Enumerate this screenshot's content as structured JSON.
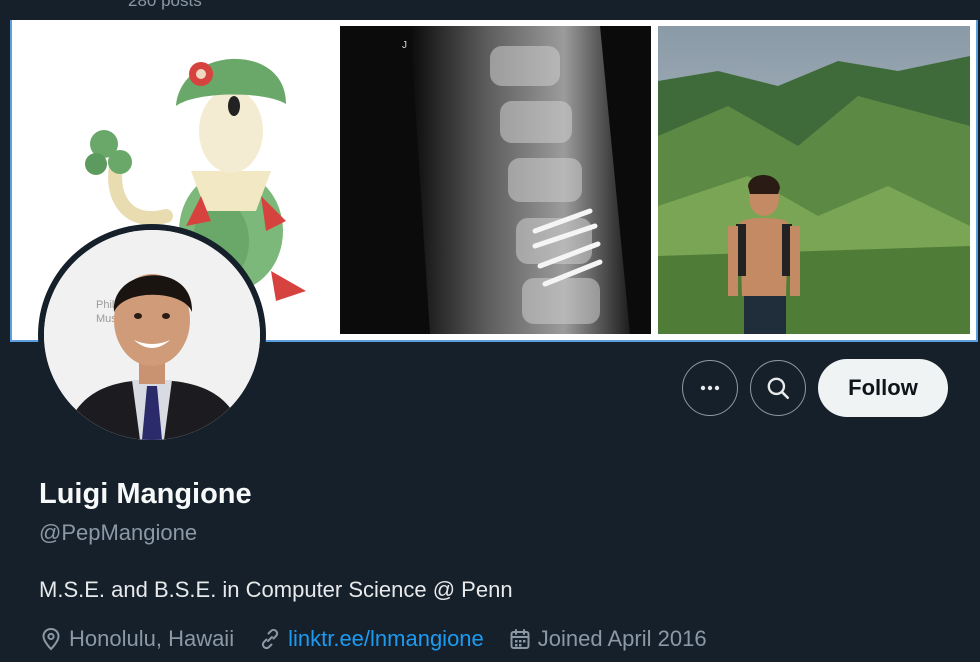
{
  "header": {
    "post_count": "280 posts"
  },
  "actions": {
    "more_icon": "more-horizontal-icon",
    "search_icon": "search-icon",
    "follow_label": "Follow"
  },
  "profile": {
    "name": "Luigi Mangione",
    "handle": "@PepMangione",
    "bio": "M.S.E. and B.S.E. in Computer Science @ Penn",
    "location": "Honolulu, Hawaii",
    "website": "linktr.ee/lnmangione",
    "joined": "Joined April 2016"
  },
  "banner": {
    "tiles": [
      "pokemon-illustration",
      "spine-xray",
      "hiking-photo"
    ]
  },
  "avatar": {
    "backdrop_text": "Philad\nMuse"
  },
  "colors": {
    "background": "#15202b",
    "secondary_text": "#8b98a5",
    "link": "#1d9bf0",
    "follow_bg": "#eff3f4"
  }
}
